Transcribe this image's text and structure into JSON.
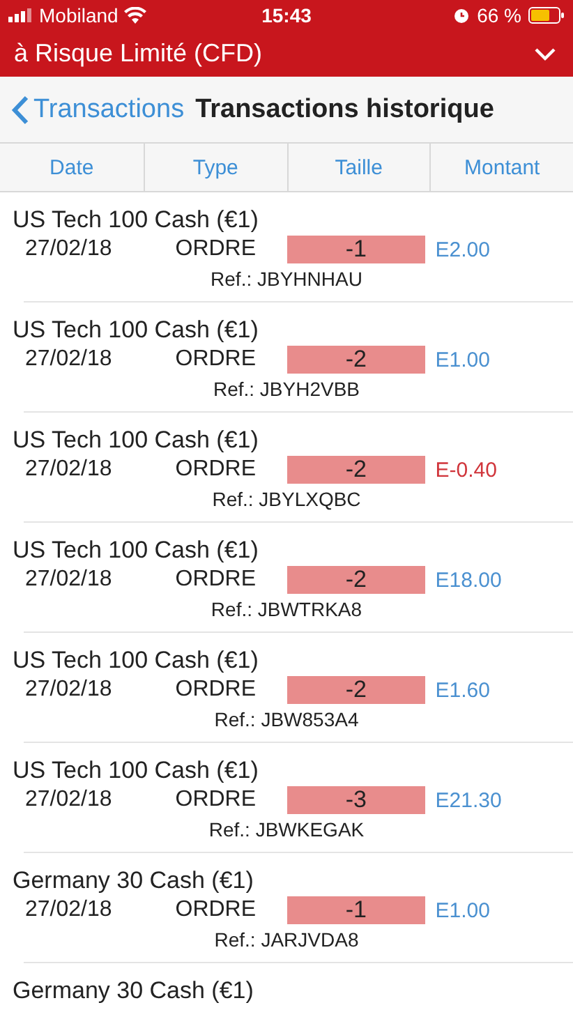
{
  "status_bar": {
    "carrier": "Mobiland",
    "time": "15:43",
    "battery": "66 %"
  },
  "account_bar": {
    "title": "à Risque Limité (CFD)"
  },
  "nav": {
    "back": "Transactions",
    "title": "Transactions historique"
  },
  "columns": [
    "Date",
    "Type",
    "Taille",
    "Montant"
  ],
  "rows": [
    {
      "name": "US Tech 100 Cash (€1)",
      "date": "27/02/18",
      "type": "ORDRE",
      "size": "-1",
      "amount": "E2.00",
      "color": "#4a90d0",
      "ref": "Ref.: JBYHNHAU"
    },
    {
      "name": "US Tech 100 Cash (€1)",
      "date": "27/02/18",
      "type": "ORDRE",
      "size": "-2",
      "amount": "E1.00",
      "color": "#4a90d0",
      "ref": "Ref.: JBYH2VBB"
    },
    {
      "name": "US Tech 100 Cash (€1)",
      "date": "27/02/18",
      "type": "ORDRE",
      "size": "-2",
      "amount": "E-0.40",
      "color": "#d0343a",
      "ref": "Ref.: JBYLXQBC"
    },
    {
      "name": "US Tech 100 Cash (€1)",
      "date": "27/02/18",
      "type": "ORDRE",
      "size": "-2",
      "amount": "E18.00",
      "color": "#4a90d0",
      "ref": "Ref.: JBWTRKA8"
    },
    {
      "name": "US Tech 100 Cash (€1)",
      "date": "27/02/18",
      "type": "ORDRE",
      "size": "-2",
      "amount": "E1.60",
      "color": "#4a90d0",
      "ref": "Ref.: JBW853A4"
    },
    {
      "name": "US Tech 100 Cash (€1)",
      "date": "27/02/18",
      "type": "ORDRE",
      "size": "-3",
      "amount": "E21.30",
      "color": "#4a90d0",
      "ref": "Ref.: JBWKEGAK"
    },
    {
      "name": "Germany 30 Cash (€1)",
      "date": "27/02/18",
      "type": "ORDRE",
      "size": "-1",
      "amount": "E1.00",
      "color": "#4a90d0",
      "ref": "Ref.: JARJVDA8"
    },
    {
      "name": "Germany 30 Cash (€1)"
    }
  ]
}
